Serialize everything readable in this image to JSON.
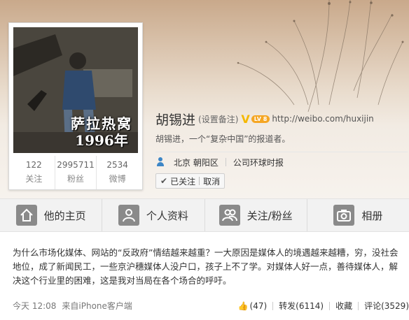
{
  "profile": {
    "name": "胡锡进",
    "remark": "(设置备注)",
    "verified_badge": "V",
    "level": "LV 8",
    "homepage_url": "http://weibo.com/huxijin",
    "bio": "胡锡进，一个“复杂中国”的报道者。",
    "location": "北京 朝阳区",
    "company": "公司环球时报",
    "follow_status": "已关注",
    "unfollow_label": "取消",
    "avatar_caption_line1": "萨拉热窝",
    "avatar_caption_line2": "1996年"
  },
  "stats": [
    {
      "value": "122",
      "label": "关注"
    },
    {
      "value": "2995711",
      "label": "粉丝"
    },
    {
      "value": "2534",
      "label": "微博"
    }
  ],
  "tabs": [
    {
      "label": "他的主页",
      "icon": "home-icon"
    },
    {
      "label": "个人资料",
      "icon": "profile-icon"
    },
    {
      "label": "关注/粉丝",
      "icon": "follow-icon"
    },
    {
      "label": "相册",
      "icon": "camera-icon"
    }
  ],
  "post": {
    "text": "为什么市场化媒体、网站的“反政府”情结越来越重？一大原因是媒体人的境遇越来越糟，穷，没社会地位，成了新闻民工，一些京沪穗媒体人没户口，孩子上不了学。对媒体人好一点，善待媒体人，解决这个行业里的困难，这是我对当局在各个场合的呼吁。",
    "time": "今天 12:08",
    "source": "来自iPhone客户端",
    "like_count": "(47)",
    "repost_label": "转发(6114)",
    "favorite_label": "收藏",
    "comment_label": "评论(3529)"
  },
  "colors": {
    "accent_blue": "#3d86c6",
    "verified_gold": "#f5b800",
    "tab_icon_gray": "#8a8a8a",
    "tab_bar_bg": "#f2f2f2"
  }
}
